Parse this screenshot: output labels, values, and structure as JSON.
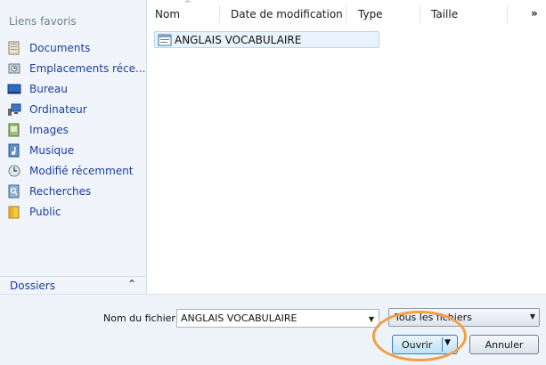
{
  "sidebar": {
    "header": "Liens favoris",
    "items": [
      {
        "label": "Documents",
        "icon": "documents-icon"
      },
      {
        "label": "Emplacements réce...",
        "icon": "recent-places-icon"
      },
      {
        "label": "Bureau",
        "icon": "desktop-icon"
      },
      {
        "label": "Ordinateur",
        "icon": "computer-icon"
      },
      {
        "label": "Images",
        "icon": "pictures-icon"
      },
      {
        "label": "Musique",
        "icon": "music-icon"
      },
      {
        "label": "Modifié récemment",
        "icon": "recently-changed-icon"
      },
      {
        "label": "Recherches",
        "icon": "searches-icon"
      },
      {
        "label": "Public",
        "icon": "public-folder-icon"
      }
    ],
    "folders_label": "Dossiers"
  },
  "file_list": {
    "columns": [
      "Nom",
      "Date de modification",
      "Type",
      "Taille"
    ],
    "more": "»",
    "files": [
      {
        "name": "ANGLAIS VOCABULAIRE",
        "icon": "document-file-icon"
      }
    ]
  },
  "bottom": {
    "filename_label": "Nom du fichier :",
    "filename_value": "ANGLAIS VOCABULAIRE",
    "filetype_value": "Tous les fichiers",
    "open_label": "Ouvrir",
    "cancel_label": "Annuler"
  },
  "colors": {
    "link_blue": "#1a3d9b",
    "highlight_ring": "#f0a045",
    "selection": "#e8f3fd"
  }
}
